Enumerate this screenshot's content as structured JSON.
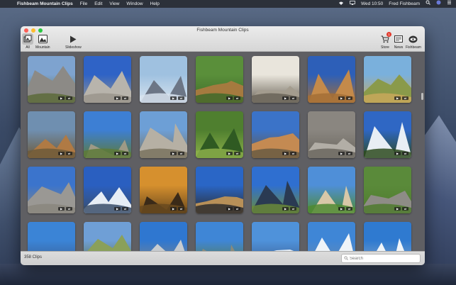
{
  "menubar": {
    "apple_icon": "",
    "app_name": "Fishbeam Mountain Clips",
    "items": [
      "File",
      "Edit",
      "View",
      "Window",
      "Help"
    ],
    "datetime": "Wed 10:50",
    "user": "Fred Fishbeam",
    "status_icons": [
      "wifi-icon",
      "cast-icon",
      "search-icon",
      "siri-icon",
      "menu-icon"
    ]
  },
  "window": {
    "title": "Fishbeam Mountain Clips",
    "toolbar_left": [
      {
        "label": "All",
        "icon": "all-clips-icon"
      },
      {
        "label": "Mountain",
        "icon": "mountain-photo-icon"
      },
      {
        "label": "Slideshow",
        "icon": "play-icon"
      }
    ],
    "toolbar_right": [
      {
        "label": "Store",
        "icon": "cart-icon",
        "badge": "1"
      },
      {
        "label": "News",
        "icon": "news-icon"
      },
      {
        "label": "Fishbeam",
        "icon": "fishbeam-logo-icon"
      }
    ]
  },
  "clips": [
    {
      "sky": "#7ea3cf",
      "rock": "#8c8a86",
      "ground": "#5c6a3a"
    },
    {
      "sky": "#2f63c6",
      "rock": "#b8b4ac",
      "ground": "#9a958c"
    },
    {
      "sky": "#9fc1e0",
      "rock": "#6c7686",
      "ground": "#d7e3ee"
    },
    {
      "sky": "#5a8f3a",
      "rock": "#a57a3f",
      "ground": "#3f6a2a"
    },
    {
      "sky": "#e9e5dc",
      "rock": "#a39c8e",
      "ground": "#6a6458"
    },
    {
      "sky": "#2d5fb8",
      "rock": "#c48a4a",
      "ground": "#a46e36"
    },
    {
      "sky": "#7ab0dc",
      "rock": "#8a9a4a",
      "ground": "#c8a85a"
    },
    {
      "sky": "#6f8fb0",
      "rock": "#b07a44",
      "ground": "#6d5a3a"
    },
    {
      "sky": "#3d7fd4",
      "rock": "#9e9a86",
      "ground": "#5d7a3a"
    },
    {
      "sky": "#6d9fd6",
      "rock": "#b6b0a4",
      "ground": "#7a735f"
    },
    {
      "sky": "#4f7f2f",
      "rock": "#2f5a22",
      "ground": "#8cb04a"
    },
    {
      "sky": "#3b73c8",
      "rock": "#c48a52",
      "ground": "#6a5a42"
    },
    {
      "sky": "#8a8680",
      "rock": "#b2aea6",
      "ground": "#6a665e"
    },
    {
      "sky": "#2f67c4",
      "rock": "#e8eef4",
      "ground": "#2d4a1f"
    },
    {
      "sky": "#3b74cc",
      "rock": "#9a9894",
      "ground": "#8a867e"
    },
    {
      "sky": "#2a5fc0",
      "rock": "#e6edf5",
      "ground": "#3a4e6a"
    },
    {
      "sky": "#d6902e",
      "rock": "#3a2a18",
      "ground": "#6a4a1e"
    },
    {
      "sky": "#2a66c6",
      "rock": "#b89058",
      "ground": "#2d2d2d"
    },
    {
      "sky": "#2f6fd0",
      "rock": "#2a3a52",
      "ground": "#6a8a3a"
    },
    {
      "sky": "#4f8fd8",
      "rock": "#d8c8a8",
      "ground": "#4f8a32"
    },
    {
      "sky": "#5a8a3a",
      "rock": "#8e8c86",
      "ground": "#4f7a2e"
    },
    {
      "sky": "#3b84d6",
      "rock": "#c0d4ea",
      "ground": "#3a5a8a"
    },
    {
      "sky": "#6f9fd6",
      "rock": "#8aa05a",
      "ground": "#5a6a3a"
    },
    {
      "sky": "#2f77d0",
      "rock": "#c8ccd0",
      "ground": "#8a8680"
    },
    {
      "sky": "#3f86d6",
      "rock": "#8a8a7a",
      "ground": "#5a7a3a"
    },
    {
      "sky": "#4f92da",
      "rock": "#e8f0f8",
      "ground": "#3a5a8a"
    },
    {
      "sky": "#3f86d6",
      "rock": "#eef3f8",
      "ground": "#6a8ab0"
    },
    {
      "sky": "#2f7ad0",
      "rock": "#f0f5fa",
      "ground": "#8aa8c8"
    }
  ],
  "footer": {
    "count_label": "358 Clips",
    "search_placeholder": "Search"
  }
}
